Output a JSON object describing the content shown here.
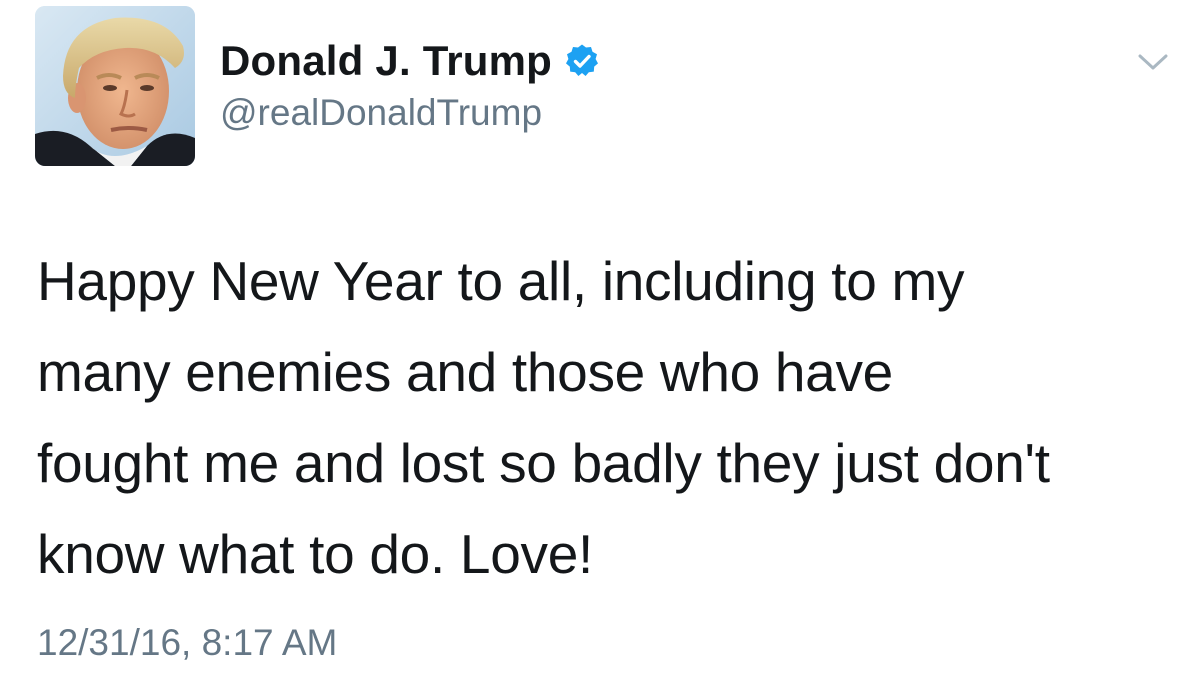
{
  "tweet": {
    "author": {
      "display_name": "Donald J. Trump",
      "handle": "@realDonaldTrump",
      "verified": true,
      "avatar_icon": "profile-photo"
    },
    "text": "Happy New Year to all, including to my\nmany enemies and those who have\nfought me and lost so badly they just don't\nknow what to do. Love!",
    "timestamp": "12/31/16, 8:17 AM",
    "menu_icon": "chevron-down-icon"
  },
  "colors": {
    "name": "#14171a",
    "secondary": "#657786",
    "verified_badge": "#1da1f2",
    "background": "#ffffff"
  }
}
